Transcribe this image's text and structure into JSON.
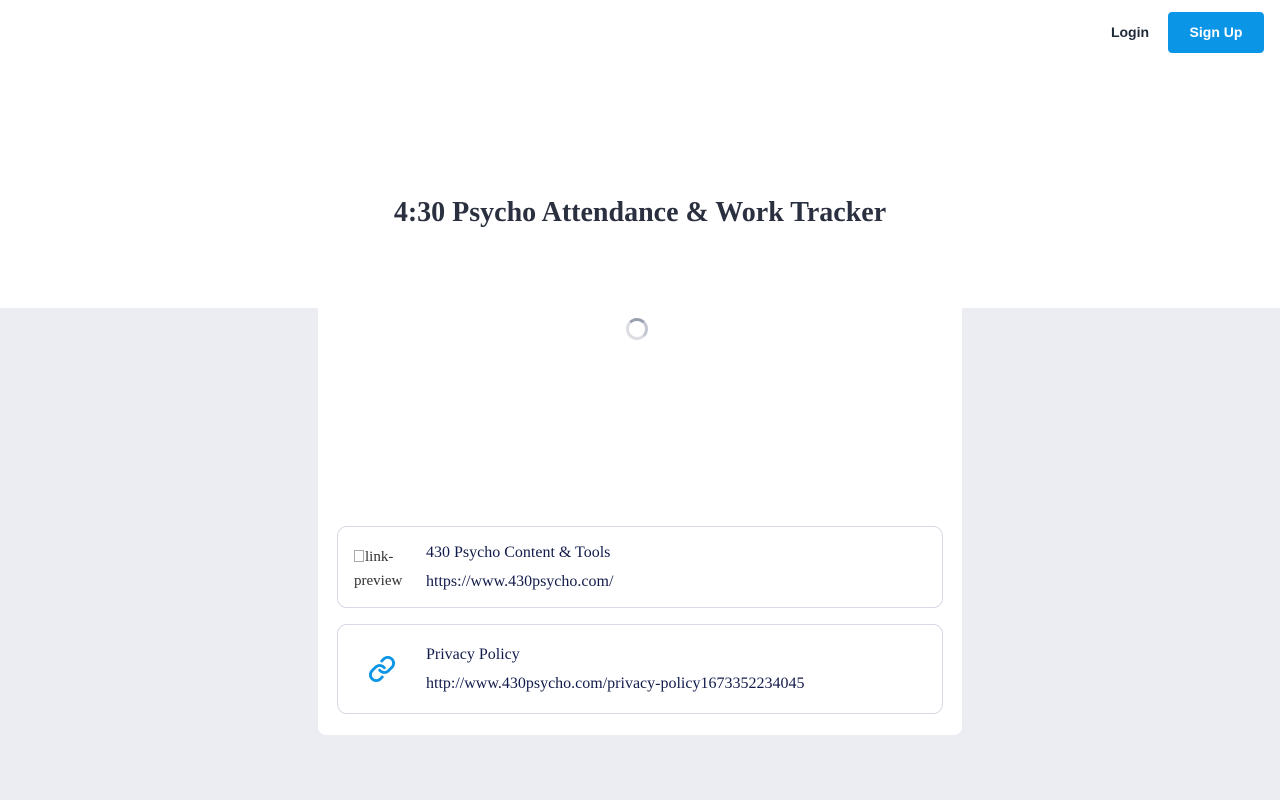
{
  "header": {
    "login_label": "Login",
    "signup_label": "Sign Up"
  },
  "page": {
    "title": "4:30 Psycho Attendance & Work Tracker"
  },
  "links": [
    {
      "preview_alt": "link-preview",
      "title": "430 Psycho Content & Tools",
      "url": "https://www.430psycho.com/"
    },
    {
      "icon": "link-icon",
      "title": "Privacy Policy",
      "url": "http://www.430psycho.com/privacy-policy1673352234045"
    }
  ],
  "colors": {
    "accent": "#0b95e6",
    "background": "#ebedf2",
    "title": "#2b3040",
    "link_text": "#111a4a"
  }
}
